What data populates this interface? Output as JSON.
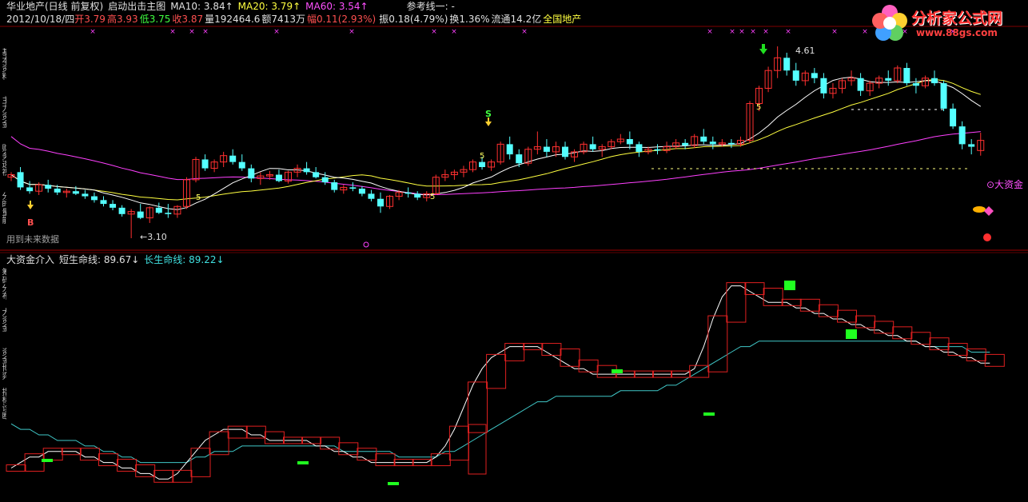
{
  "header": {
    "stock_name": "华业地产(日线 前复权)",
    "indicator": "启动出击主图",
    "ma10_label": "MA10: 3.84↑",
    "ma20_label": "MA20: 3.79↑",
    "ma60_label": "MA60: 3.54↑",
    "ref_line": "参考线一: -"
  },
  "info": {
    "date": "2012/10/18/四",
    "open": "开3.79",
    "high": "高3.93",
    "low": "低3.75",
    "close": "收3.87",
    "volume": "量192464.6",
    "amount": "额7413万",
    "change": "幅0.11(2.93%)",
    "amplitude": "振0.18(4.79%)",
    "turnover": "换1.36%",
    "float": "流通14.2亿",
    "sector": "全国地产"
  },
  "main_chart": {
    "future_data_note": "用到未来数据",
    "low_price_label": "←3.10",
    "high_price_label": "4.61",
    "buy_label": "B",
    "sell_label": "S",
    "five_label": "5",
    "big_money_label": "⊙大资金"
  },
  "sub_chart": {
    "title": "大资金介入",
    "short_label": "短生命线: 89.67↓",
    "long_label": "长生命线: 89.22↓"
  },
  "logo": {
    "title": "分析家公式网",
    "url": "www.88gs.com"
  },
  "left_tabs": [
    "基本资料",
    "主力资金",
    "财务透视",
    "分时量能",
    "筹码分布",
    "大资金",
    "资金博弈",
    "指标诊断"
  ],
  "colors": {
    "up": "#ff3030",
    "down": "#54ffff",
    "ma10": "#ffffff",
    "ma20": "#ffff40",
    "ma60": "#ff40ff",
    "short_line": "#ffffff",
    "long_line": "#40c8c8",
    "volume_box": "#e02020",
    "green_block": "#20ff20"
  },
  "chart_data": {
    "type": "candlestick",
    "y_range": [
      3.1,
      4.61
    ],
    "candles": [
      [
        3.58,
        3.62,
        3.55,
        3.6
      ],
      [
        3.62,
        3.66,
        3.48,
        3.5
      ],
      [
        3.5,
        3.55,
        3.45,
        3.47
      ],
      [
        3.47,
        3.54,
        3.44,
        3.52
      ],
      [
        3.52,
        3.56,
        3.46,
        3.49
      ],
      [
        3.49,
        3.52,
        3.44,
        3.46
      ],
      [
        3.46,
        3.49,
        3.42,
        3.47
      ],
      [
        3.47,
        3.51,
        3.44,
        3.45
      ],
      [
        3.45,
        3.48,
        3.41,
        3.43
      ],
      [
        3.43,
        3.46,
        3.38,
        3.4
      ],
      [
        3.4,
        3.43,
        3.35,
        3.37
      ],
      [
        3.37,
        3.4,
        3.32,
        3.34
      ],
      [
        3.34,
        3.36,
        3.27,
        3.29
      ],
      [
        3.29,
        3.33,
        3.1,
        3.31
      ],
      [
        3.31,
        3.37,
        3.25,
        3.26
      ],
      [
        3.26,
        3.35,
        3.22,
        3.34
      ],
      [
        3.34,
        3.38,
        3.29,
        3.3
      ],
      [
        3.3,
        3.37,
        3.26,
        3.29
      ],
      [
        3.29,
        3.36,
        3.26,
        3.35
      ],
      [
        3.35,
        3.58,
        3.33,
        3.56
      ],
      [
        3.56,
        3.74,
        3.54,
        3.72
      ],
      [
        3.72,
        3.76,
        3.63,
        3.65
      ],
      [
        3.65,
        3.72,
        3.62,
        3.7
      ],
      [
        3.7,
        3.78,
        3.66,
        3.75
      ],
      [
        3.75,
        3.8,
        3.68,
        3.7
      ],
      [
        3.7,
        3.76,
        3.63,
        3.65
      ],
      [
        3.65,
        3.68,
        3.54,
        3.57
      ],
      [
        3.57,
        3.62,
        3.52,
        3.59
      ],
      [
        3.59,
        3.63,
        3.56,
        3.6
      ],
      [
        3.6,
        3.64,
        3.54,
        3.55
      ],
      [
        3.55,
        3.63,
        3.53,
        3.62
      ],
      [
        3.62,
        3.68,
        3.58,
        3.65
      ],
      [
        3.65,
        3.7,
        3.6,
        3.62
      ],
      [
        3.62,
        3.66,
        3.57,
        3.58
      ],
      [
        3.58,
        3.62,
        3.52,
        3.54
      ],
      [
        3.54,
        3.56,
        3.46,
        3.48
      ],
      [
        3.48,
        3.52,
        3.45,
        3.5
      ],
      [
        3.5,
        3.54,
        3.47,
        3.49
      ],
      [
        3.49,
        3.51,
        3.43,
        3.45
      ],
      [
        3.45,
        3.48,
        3.39,
        3.41
      ],
      [
        3.41,
        3.46,
        3.3,
        3.35
      ],
      [
        3.35,
        3.44,
        3.33,
        3.43
      ],
      [
        3.43,
        3.48,
        3.4,
        3.46
      ],
      [
        3.46,
        3.5,
        3.42,
        3.45
      ],
      [
        3.45,
        3.47,
        3.4,
        3.42
      ],
      [
        3.42,
        3.47,
        3.39,
        3.45
      ],
      [
        3.45,
        3.6,
        3.44,
        3.58
      ],
      [
        3.58,
        3.64,
        3.55,
        3.6
      ],
      [
        3.6,
        3.64,
        3.56,
        3.62
      ],
      [
        3.62,
        3.67,
        3.58,
        3.64
      ],
      [
        3.64,
        3.72,
        3.62,
        3.7
      ],
      [
        3.7,
        3.74,
        3.64,
        3.66
      ],
      [
        3.66,
        3.72,
        3.63,
        3.7
      ],
      [
        3.7,
        3.86,
        3.68,
        3.84
      ],
      [
        3.84,
        3.9,
        3.72,
        3.76
      ],
      [
        3.76,
        3.8,
        3.66,
        3.69
      ],
      [
        3.69,
        3.82,
        3.67,
        3.8
      ],
      [
        3.8,
        3.94,
        3.76,
        3.82
      ],
      [
        3.82,
        3.88,
        3.74,
        3.78
      ],
      [
        3.78,
        3.86,
        3.74,
        3.82
      ],
      [
        3.82,
        3.86,
        3.72,
        3.74
      ],
      [
        3.74,
        3.8,
        3.7,
        3.78
      ],
      [
        3.78,
        3.86,
        3.76,
        3.84
      ],
      [
        3.84,
        3.9,
        3.78,
        3.8
      ],
      [
        3.8,
        3.84,
        3.74,
        3.82
      ],
      [
        3.82,
        3.88,
        3.8,
        3.86
      ],
      [
        3.86,
        3.92,
        3.84,
        3.88
      ],
      [
        3.88,
        3.94,
        3.8,
        3.84
      ],
      [
        3.84,
        3.86,
        3.74,
        3.78
      ],
      [
        3.78,
        3.82,
        3.76,
        3.8
      ],
      [
        3.8,
        3.84,
        3.76,
        3.79
      ],
      [
        3.79,
        3.86,
        3.77,
        3.82
      ],
      [
        3.82,
        3.88,
        3.8,
        3.85
      ],
      [
        3.85,
        3.88,
        3.8,
        3.83
      ],
      [
        3.83,
        3.92,
        3.81,
        3.9
      ],
      [
        3.9,
        3.96,
        3.84,
        3.86
      ],
      [
        3.86,
        3.9,
        3.8,
        3.84
      ],
      [
        3.84,
        3.88,
        3.82,
        3.85
      ],
      [
        3.85,
        3.88,
        3.81,
        3.84
      ],
      [
        3.84,
        3.9,
        3.82,
        3.87
      ],
      [
        3.87,
        4.18,
        3.85,
        4.16
      ],
      [
        4.16,
        4.3,
        4.1,
        4.28
      ],
      [
        4.28,
        4.45,
        4.25,
        4.42
      ],
      [
        4.42,
        4.61,
        4.36,
        4.52
      ],
      [
        4.52,
        4.56,
        4.38,
        4.42
      ],
      [
        4.42,
        4.48,
        4.3,
        4.34
      ],
      [
        4.34,
        4.42,
        4.3,
        4.4
      ],
      [
        4.4,
        4.44,
        4.32,
        4.36
      ],
      [
        4.36,
        4.4,
        4.2,
        4.24
      ],
      [
        4.24,
        4.32,
        4.2,
        4.28
      ],
      [
        4.28,
        4.36,
        4.24,
        4.34
      ],
      [
        4.34,
        4.42,
        4.3,
        4.36
      ],
      [
        4.36,
        4.4,
        4.22,
        4.26
      ],
      [
        4.26,
        4.34,
        4.22,
        4.32
      ],
      [
        4.32,
        4.38,
        4.28,
        4.36
      ],
      [
        4.36,
        4.42,
        4.3,
        4.34
      ],
      [
        4.34,
        4.46,
        4.32,
        4.44
      ],
      [
        4.44,
        4.48,
        4.3,
        4.32
      ],
      [
        4.32,
        4.36,
        4.24,
        4.3
      ],
      [
        4.3,
        4.38,
        4.28,
        4.36
      ],
      [
        4.36,
        4.42,
        4.3,
        4.32
      ],
      [
        4.32,
        4.34,
        4.1,
        4.12
      ],
      [
        4.12,
        4.16,
        3.96,
        3.98
      ],
      [
        3.98,
        4.02,
        3.8,
        3.84
      ],
      [
        3.84,
        3.88,
        3.76,
        3.82
      ],
      [
        3.79,
        3.93,
        3.75,
        3.87
      ]
    ],
    "short_line": [
      55,
      56,
      57,
      57,
      58,
      58,
      58,
      58,
      57,
      57,
      56,
      56,
      55,
      55,
      54,
      54,
      53,
      53,
      54,
      56,
      58,
      60,
      61,
      62,
      62,
      62,
      61,
      61,
      60,
      60,
      60,
      60,
      60,
      59,
      59,
      58,
      58,
      57,
      57,
      56,
      56,
      56,
      56,
      56,
      56,
      56,
      57,
      59,
      62,
      66,
      70,
      73,
      75,
      76,
      77,
      77,
      77,
      77,
      76,
      75,
      74,
      73,
      73,
      72,
      72,
      72,
      72,
      72,
      72,
      72,
      72,
      72,
      72,
      72,
      73,
      77,
      82,
      86,
      88,
      88,
      87,
      86,
      85,
      85,
      85,
      84,
      84,
      83,
      83,
      82,
      82,
      81,
      81,
      80,
      80,
      79,
      79,
      78,
      78,
      77,
      77,
      76,
      76,
      75,
      75,
      74,
      74
    ],
    "long_line": [
      63,
      62,
      62,
      61,
      61,
      60,
      60,
      60,
      59,
      59,
      58,
      58,
      57,
      57,
      56,
      56,
      56,
      56,
      56,
      56,
      57,
      57,
      58,
      58,
      58,
      59,
      59,
      59,
      59,
      59,
      59,
      59,
      59,
      59,
      59,
      59,
      58,
      58,
      58,
      58,
      58,
      58,
      57,
      57,
      57,
      57,
      57,
      58,
      58,
      59,
      60,
      61,
      62,
      63,
      64,
      65,
      66,
      67,
      67,
      68,
      68,
      68,
      68,
      68,
      68,
      68,
      69,
      69,
      69,
      69,
      69,
      70,
      70,
      71,
      72,
      73,
      74,
      75,
      76,
      77,
      77,
      78,
      78,
      78,
      78,
      78,
      78,
      78,
      78,
      78,
      78,
      78,
      78,
      78,
      78,
      78,
      78,
      78,
      78,
      77,
      77,
      77,
      77,
      77,
      76,
      76,
      76
    ]
  }
}
